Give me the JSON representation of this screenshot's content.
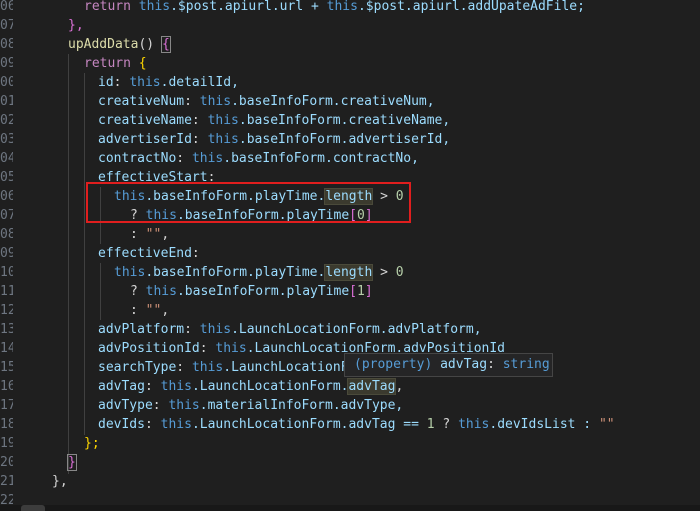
{
  "line_numbers": [
    "06",
    "07",
    "08",
    "09",
    "00",
    "01",
    "02",
    "03",
    "04",
    "05",
    "06",
    "07",
    "08",
    "09",
    "10",
    "11",
    "12",
    "13",
    "14",
    "15",
    "16",
    "17",
    "18",
    "19",
    "20",
    "21",
    "22"
  ],
  "code": {
    "l0": {
      "return": "return",
      "this1": "this",
      "seg1": ".$post.apiurl.url + ",
      "this2": "this",
      "seg2": ".$post.apiurl.addUpateAdFile;"
    },
    "l1": {
      "close": "},"
    },
    "l2": {
      "fn": "upAddData",
      "parens": "() ",
      "open": "{"
    },
    "l3": {
      "return": "return",
      "open": "{"
    },
    "l4": {
      "key": "id",
      "colon": ": ",
      "this": "this",
      "rest": ".detailId,"
    },
    "l5": {
      "key": "creativeNum",
      "colon": ": ",
      "this": "this",
      "rest": ".baseInfoForm.creativeNum,"
    },
    "l6": {
      "key": "creativeName",
      "colon": ": ",
      "this": "this",
      "rest": ".baseInfoForm.creativeName,"
    },
    "l7": {
      "key": "advertiserId",
      "colon": ": ",
      "this": "this",
      "rest": ".baseInfoForm.advertiserId,"
    },
    "l8": {
      "key": "contractNo",
      "colon": ": ",
      "this": "this",
      "rest": ".baseInfoForm.contractNo,"
    },
    "l9": {
      "key": "effectiveStart",
      "colon": ":"
    },
    "l10": {
      "this": "this",
      "rest": ".baseInfoForm.playTime.",
      "length": "length",
      "op": " > ",
      "num": "0"
    },
    "l11": {
      "q": "? ",
      "this": "this",
      "rest": ".baseInfoForm.playTime",
      "ob": "[",
      "num": "0",
      "cb": "]"
    },
    "l12": {
      "colon": ": ",
      "str": "\"\"",
      "comma": ","
    },
    "l13": {
      "key": "effectiveEnd",
      "colon": ":"
    },
    "l14": {
      "this": "this",
      "rest": ".baseInfoForm.playTime.",
      "length": "length",
      "op": " > ",
      "num": "0"
    },
    "l15": {
      "q": "? ",
      "this": "this",
      "rest": ".baseInfoForm.playTime",
      "ob": "[",
      "num": "1",
      "cb": "]"
    },
    "l16": {
      "colon": ": ",
      "str": "\"\"",
      "comma": ","
    },
    "l17": {
      "key": "advPlatform",
      "colon": ": ",
      "this": "this",
      "rest": ".LaunchLocationForm.advPlatform,"
    },
    "l18": {
      "key": "advPositionId",
      "colon": ": ",
      "this": "this",
      "rest": ".LaunchLocationForm.advPositionId"
    },
    "l19": {
      "key": "searchType",
      "colon": ": ",
      "this": "this",
      "rest": ".LaunchLocationF"
    },
    "l20": {
      "key": "advTag",
      "colon": ": ",
      "this": "this",
      "rest": ".LaunchLocationForm.",
      "hl": "advTag",
      "comma": ","
    },
    "l21": {
      "key": "advType",
      "colon": ": ",
      "this": "this",
      "rest": ".materialInfoForm.advType,"
    },
    "l22": {
      "key": "devIds",
      "colon": ": ",
      "this": "this",
      "rest": ".LaunchLocationForm.advTag == ",
      "num": "1",
      "q": " ? ",
      "this2": "this",
      "rest2": ".devIdsList : ",
      "str": "\"\""
    },
    "l23": {
      "close": "};"
    },
    "l24": {
      "close": "}"
    },
    "l25": {
      "close": "},"
    }
  },
  "tooltip": {
    "label": "(property)",
    "name": "advTag",
    "colon": ":",
    "type": "string"
  },
  "colors": {
    "background": "#1f1f1f",
    "keyword_blue": "#569cd6",
    "keyword_pink": "#c586c0",
    "identifier": "#9cdcfe",
    "function": "#dcdcaa",
    "number": "#b5cea8",
    "string": "#ce9178",
    "annotation_box": "#e01e1e"
  }
}
